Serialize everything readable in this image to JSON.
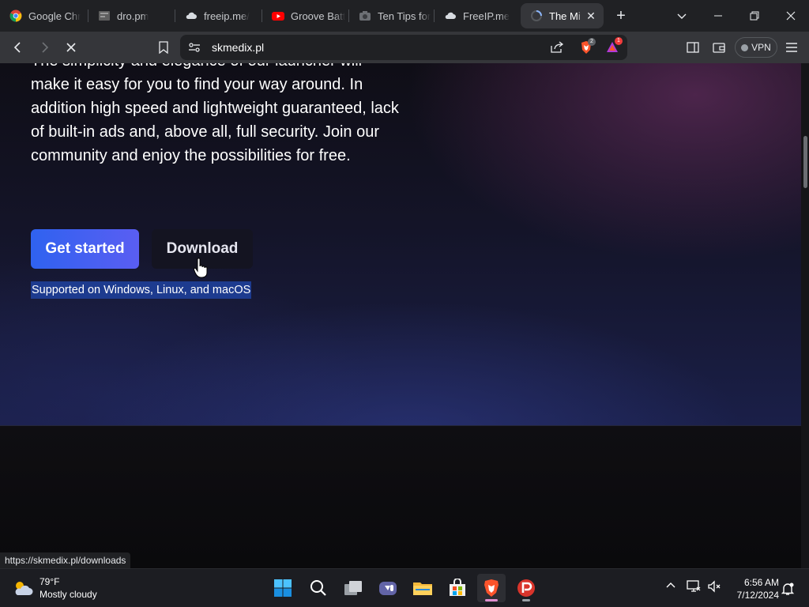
{
  "browser": {
    "tabs": [
      {
        "label": "Google Chr",
        "icon": "chrome-icon"
      },
      {
        "label": "dro.pm",
        "icon": "doc-icon"
      },
      {
        "label": "freeip.me/",
        "icon": "cloud-icon"
      },
      {
        "label": "Groove Batt",
        "icon": "youtube-icon"
      },
      {
        "label": "Ten Tips for",
        "icon": "camera-icon"
      },
      {
        "label": "FreeIP.me",
        "icon": "cloud-icon"
      },
      {
        "label": "The Mi",
        "icon": "loading-spinner-icon",
        "active": true
      }
    ],
    "address_bar": {
      "url": "skmedix.pl"
    },
    "brave_shield_count": "2",
    "rewards_count": "1",
    "vpn_label": "VPN"
  },
  "page": {
    "hero_text": "make it easy for you to find your way around. In addition high speed and lightweight guaranteed, lack of built-in ads and, above all, full security. Join our community and enjoy the possibilities for free.",
    "hero_text_partial_top": "The simplicity and elegance of our launcher will",
    "primary_button": "Get started",
    "secondary_button": "Download",
    "supported_text": "Supported on Windows, Linux, and macOS"
  },
  "status_bar": {
    "url": "https://skmedix.pl/downloads"
  },
  "taskbar": {
    "weather": {
      "temp": "79°F",
      "condition": "Mostly cloudy"
    },
    "apps": [
      "start",
      "search",
      "task-view",
      "teams",
      "file-explorer",
      "store",
      "brave",
      "psiphon"
    ],
    "clock": {
      "time": "6:56 AM",
      "date": "7/12/2024"
    }
  },
  "colors": {
    "primary_button_start": "#2f62f0",
    "primary_button_end": "#5a5ef2",
    "selection": "#1d3b8f",
    "brave_orange": "#fb542b"
  }
}
